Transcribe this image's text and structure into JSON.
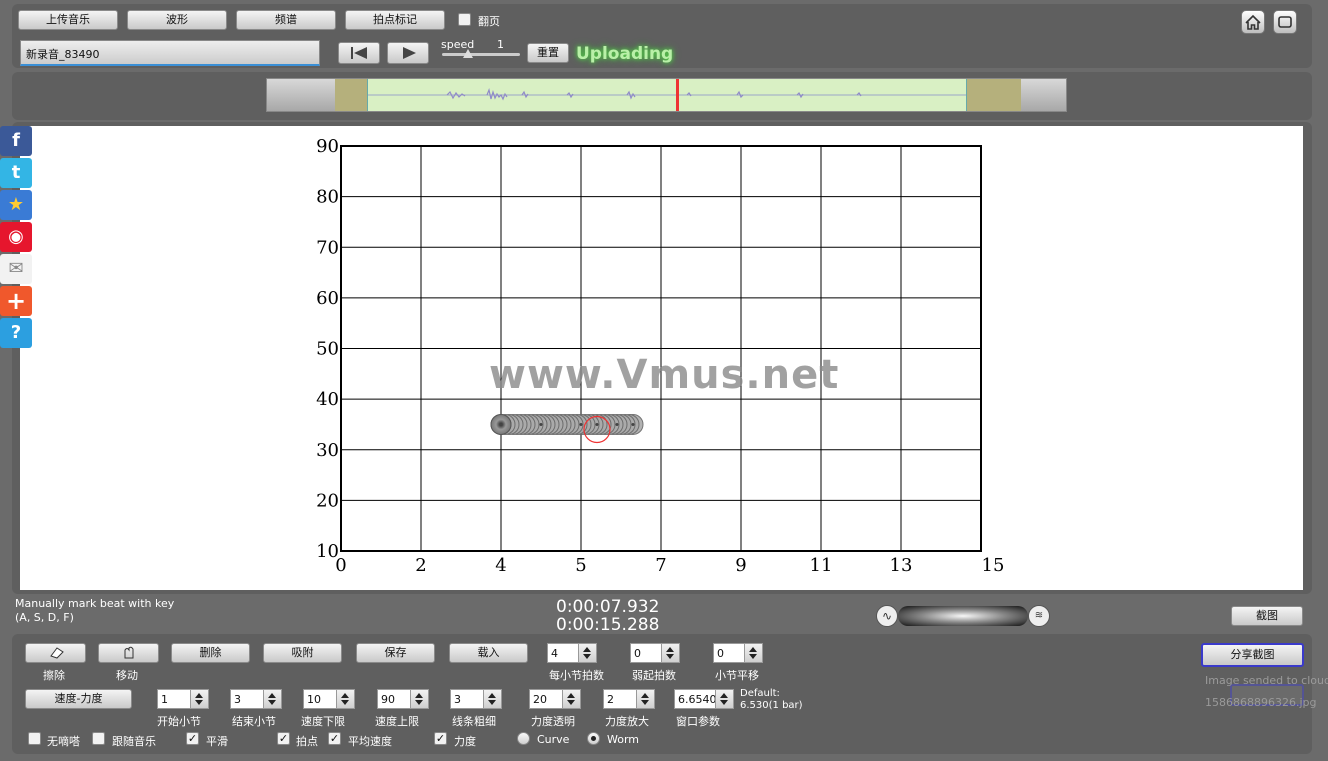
{
  "toolbar": {
    "upload": "上传音乐",
    "waveform": "波形",
    "spectrum": "频谱",
    "beat_mark": "拍点标记",
    "page_turn": "翻页",
    "reset": "重置",
    "speed_label": "speed",
    "speed_value": "1",
    "status": "Uploading"
  },
  "file": {
    "name": "新录音_83490"
  },
  "plot": {
    "watermark": "www.Vmus.net",
    "chart_data": {
      "type": "scatter",
      "x_ticks": [
        "0",
        "2",
        "4",
        "5",
        "7",
        "9",
        "11",
        "13",
        "15"
      ],
      "y_ticks": [
        "90",
        "80",
        "70",
        "60",
        "50",
        "40",
        "30",
        "20",
        "10"
      ],
      "ylim": [
        10,
        90
      ],
      "series": [
        {
          "points": [
            [
              4.0,
              35
            ],
            [
              4.5,
              35
            ],
            [
              5.0,
              35
            ],
            [
              5.4,
              35
            ],
            [
              5.9,
              35
            ],
            [
              6.3,
              35
            ]
          ]
        }
      ],
      "current_marker": [
        5.4,
        34
      ]
    }
  },
  "status": {
    "hint_line1": "Manually mark beat with key",
    "hint_line2": "(A, S, D, F)",
    "time_current": "0:00:07.932",
    "time_total": "0:00:15.288",
    "screenshot": "截图"
  },
  "tools": {
    "erase": "擦除",
    "move": "移动",
    "delete": "删除",
    "snap": "吸附",
    "save": "保存",
    "load": "载入",
    "tempo_dynamics": "速度-力度",
    "share_screenshot": "分享截图"
  },
  "params": {
    "beats_per_bar": {
      "value": "4",
      "label": "每小节拍数"
    },
    "pickup_beats": {
      "value": "0",
      "label": "弱起拍数"
    },
    "bar_offset": {
      "value": "0",
      "label": "小节平移"
    },
    "start_bar": {
      "value": "1",
      "label": "开始小节"
    },
    "end_bar": {
      "value": "3",
      "label": "结束小节"
    },
    "speed_min": {
      "value": "10",
      "label": "速度下限"
    },
    "speed_max": {
      "value": "90",
      "label": "速度上限"
    },
    "line_width": {
      "value": "3",
      "label": "线条粗细"
    },
    "dyn_alpha": {
      "value": "20",
      "label": "力度透明"
    },
    "dyn_scale": {
      "value": "2",
      "label": "力度放大"
    },
    "window": {
      "value": "6.6540",
      "label": "窗口参数"
    },
    "default_line1": "Default:",
    "default_line2": "6.530(1 bar)"
  },
  "options": {
    "no_click": "无嘀嗒",
    "follow_music": "跟随音乐",
    "smooth": "平滑",
    "beat_points": "拍点",
    "avg_speed": "平均速度",
    "dynamics": "力度",
    "curve": "Curve",
    "worm": "Worm"
  },
  "share_status": {
    "line1": "Image sended to cloud",
    "line2": "1586868896326.jpg"
  },
  "colors": {
    "background": "#6b6b6b",
    "status_green": "#7ee07a",
    "selection": "#d9f0c4"
  }
}
